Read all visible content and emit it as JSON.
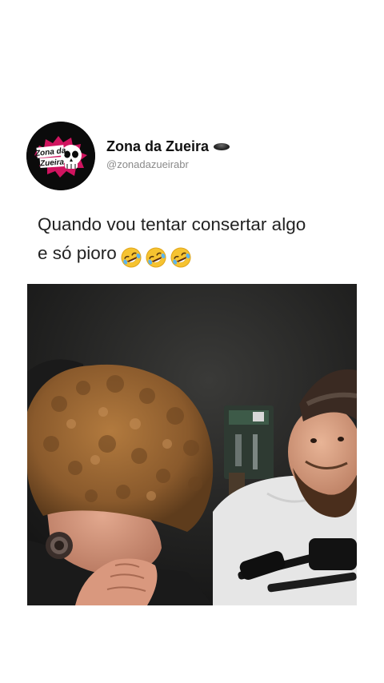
{
  "account": {
    "name": "Zona da Zueira",
    "handle": "@zonadazueirabr",
    "avatar_logo_text": "Zona da Zueira",
    "verified_icon": "black-circle-icon"
  },
  "post": {
    "caption_line1": "Quando vou tentar consertar algo",
    "caption_line2": "e só pioro",
    "caption_emojis": [
      "rolling-on-floor-laughing-icon",
      "rolling-on-floor-laughing-icon",
      "rolling-on-floor-laughing-icon"
    ]
  },
  "media": {
    "type": "video-frame",
    "icon": "video-still-image"
  },
  "colors": {
    "background": "#ffffff",
    "name_text": "#111111",
    "handle_text": "#8a8a8a",
    "caption_text": "#222222",
    "avatar_bg": "#0b0b0b",
    "avatar_accent": "#d0145f"
  }
}
